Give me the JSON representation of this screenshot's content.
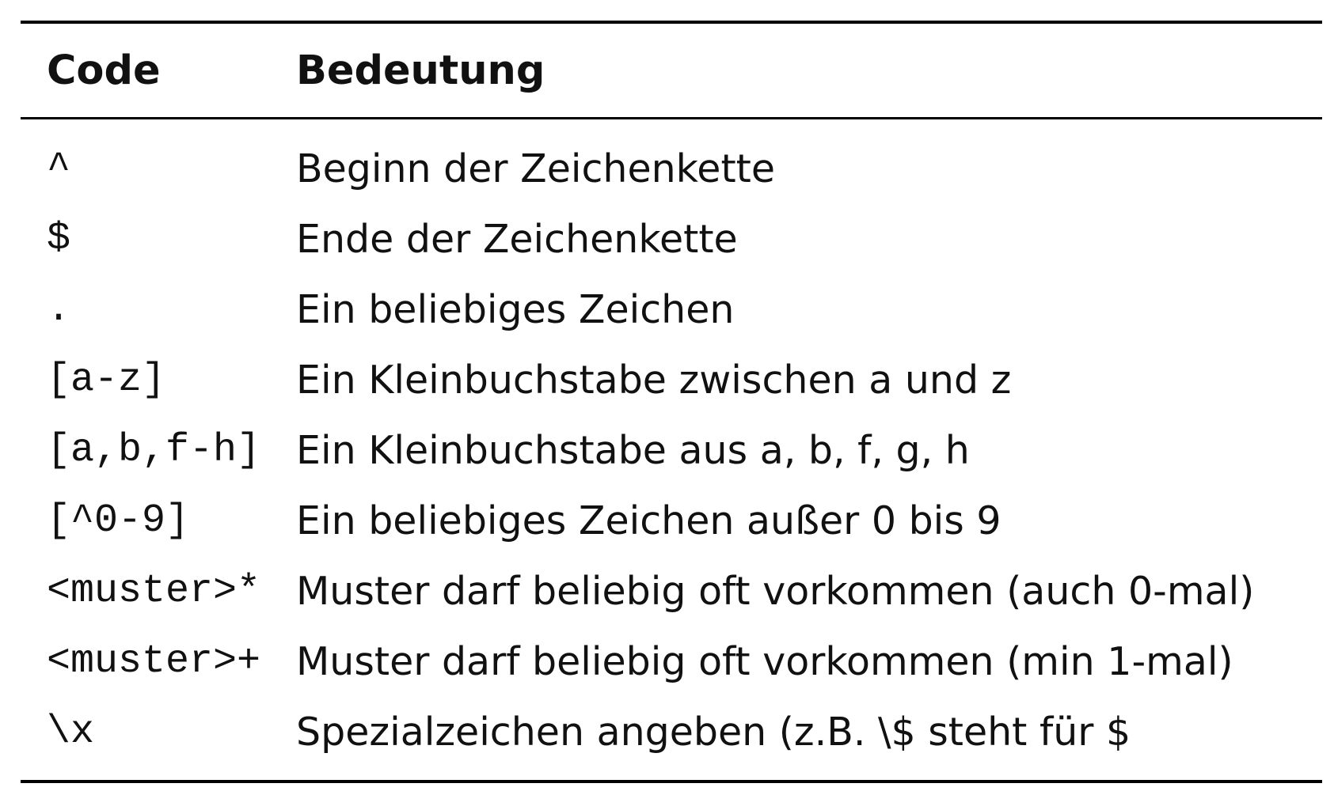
{
  "table": {
    "headers": {
      "code": "Code",
      "meaning": "Bedeutung"
    },
    "rows": [
      {
        "code": "^",
        "meaning": "Beginn der Zeichenkette"
      },
      {
        "code": "$",
        "meaning": "Ende der Zeichenkette"
      },
      {
        "code": ".",
        "meaning": "Ein beliebiges Zeichen"
      },
      {
        "code": "[a-z]",
        "meaning": "Ein Kleinbuchstabe zwischen a und z"
      },
      {
        "code": "[a,b,f-h]",
        "meaning": "Ein Kleinbuchstabe aus a, b, f, g, h"
      },
      {
        "code": "[^0-9]",
        "meaning": "Ein beliebiges Zeichen außer 0 bis 9"
      },
      {
        "code": "<muster>*",
        "meaning": "Muster darf beliebig oft vorkommen (auch 0-mal)"
      },
      {
        "code": "<muster>+",
        "meaning": "Muster darf beliebig oft vorkommen (min 1-mal)"
      },
      {
        "code": "\\x",
        "meaning": "Spezialzeichen angeben (z.B. \\$ steht für $"
      }
    ]
  }
}
